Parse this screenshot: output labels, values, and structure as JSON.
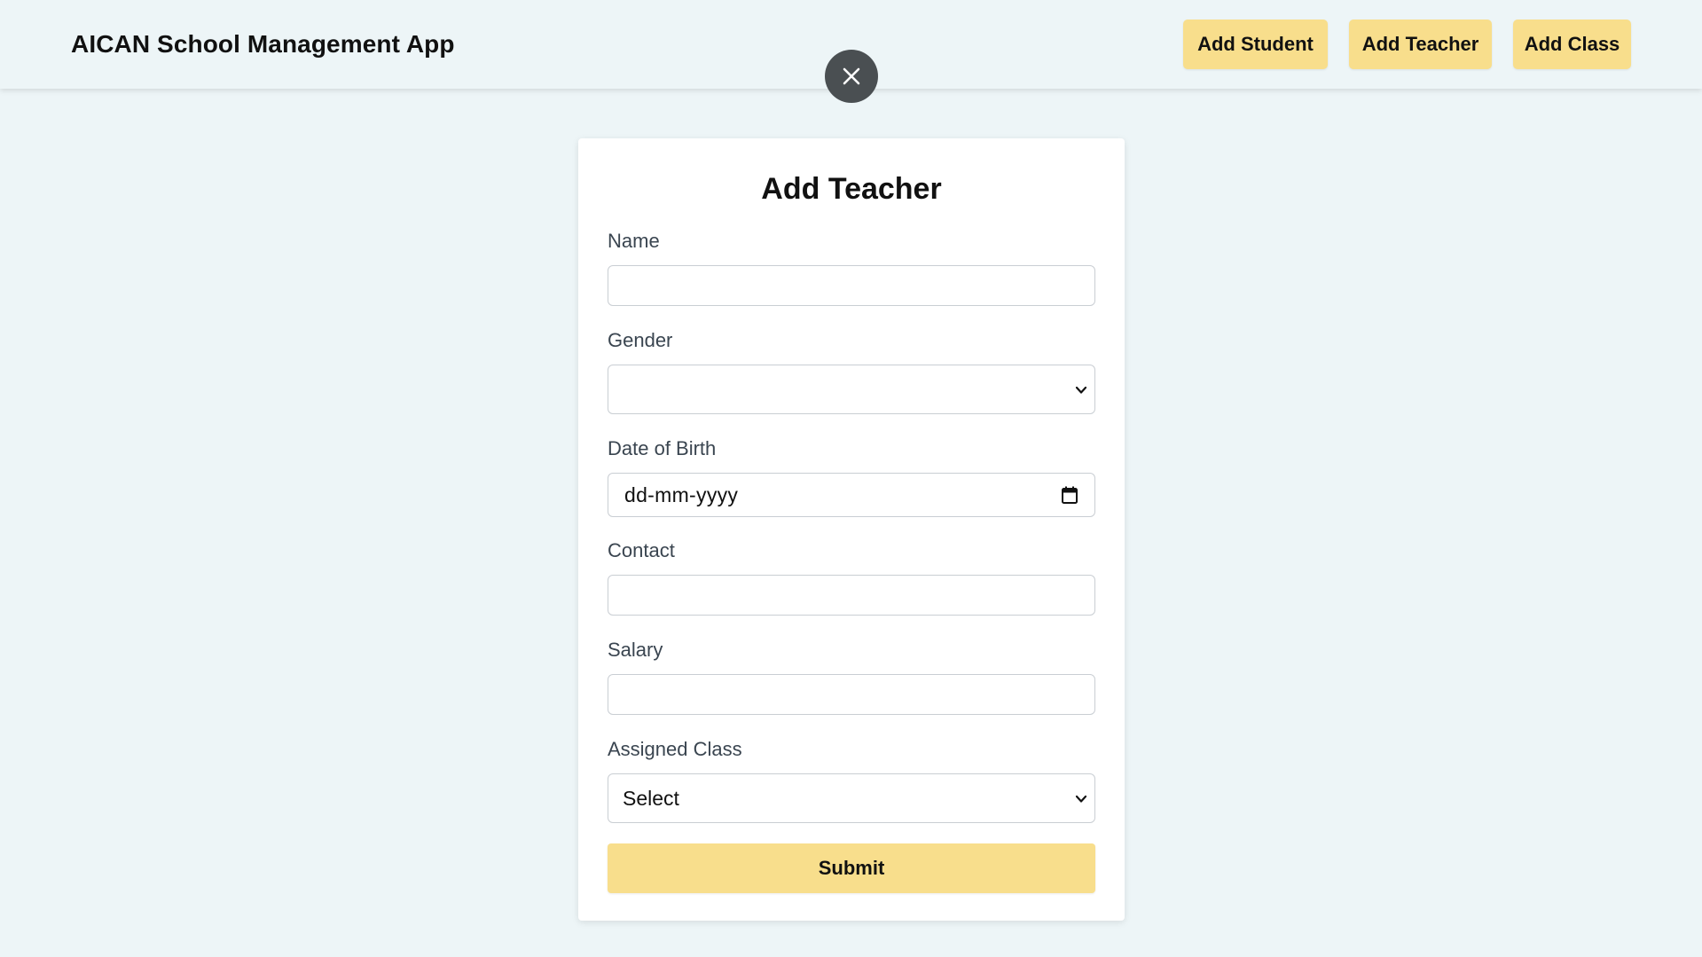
{
  "header": {
    "app_title": "AICAN School Management App",
    "nav_buttons": {
      "add_student": "Add Student",
      "add_teacher": "Add Teacher",
      "add_class": "Add Class"
    }
  },
  "close_button": {
    "icon": "close-icon"
  },
  "form": {
    "title": "Add Teacher",
    "fields": {
      "name": {
        "label": "Name",
        "value": ""
      },
      "gender": {
        "label": "Gender",
        "value": ""
      },
      "dob": {
        "label": "Date of Birth",
        "placeholder": "dd-mm-yyyy",
        "icon": "calendar-icon"
      },
      "contact": {
        "label": "Contact",
        "value": ""
      },
      "salary": {
        "label": "Salary",
        "value": ""
      },
      "assigned_class": {
        "label": "Assigned Class",
        "value": "Select"
      }
    },
    "submit_label": "Submit"
  },
  "colors": {
    "background": "#edf5f7",
    "accent_button": "#f8de8c",
    "close_button": "#4a4f52",
    "card": "#ffffff"
  }
}
